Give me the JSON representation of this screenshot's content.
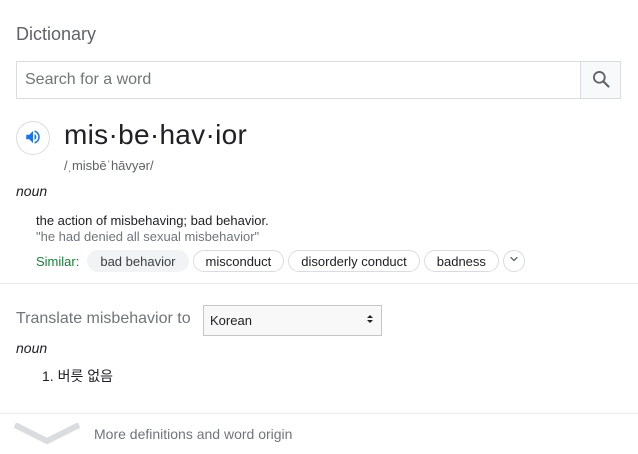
{
  "card": {
    "title": "Dictionary"
  },
  "search": {
    "placeholder": "Search for a word",
    "value": ""
  },
  "entry": {
    "headword": "mis·be·hav·ior",
    "phonetic": "/ˌmisbēˈhāvyər/",
    "part_of_speech": "noun",
    "definition": "the action of misbehaving; bad behavior.",
    "example": "\"he had denied all sexual misbehavior\"",
    "similar_label": "Similar:",
    "similar": [
      "bad behavior",
      "misconduct",
      "disorderly conduct",
      "badness"
    ]
  },
  "translate": {
    "label": "Translate misbehavior to",
    "language": "Korean",
    "part_of_speech": "noun",
    "items": [
      "1. 버릇 없음"
    ]
  },
  "footer": {
    "more_definitions": "More definitions and word origin"
  },
  "colors": {
    "similar_label": "#188038",
    "speaker_icon": "#1a73e8",
    "muted_text": "#70757a"
  },
  "icons": {
    "search": "search-icon",
    "speaker": "speaker-icon",
    "more_similar": "chevron-down-icon",
    "expand": "chevron-down-icon"
  }
}
